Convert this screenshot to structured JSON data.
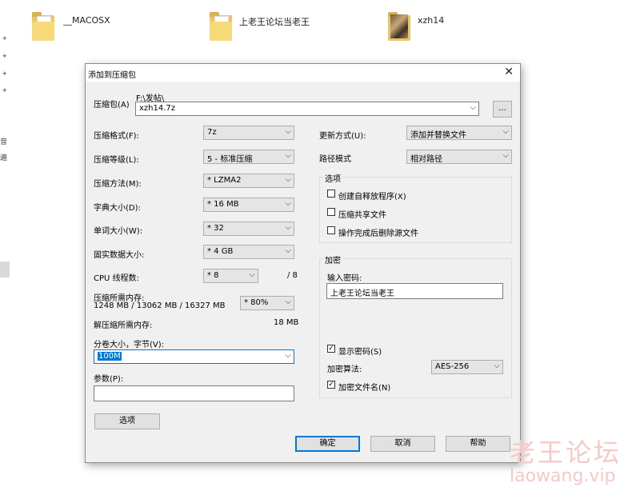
{
  "explorer": {
    "items": [
      {
        "label": "__MACOSX"
      },
      {
        "label": "上老王论坛当老王"
      },
      {
        "label": "xzh14"
      }
    ],
    "left_fragments": [
      "音",
      "遍"
    ]
  },
  "dialog": {
    "title": "添加到压缩包",
    "archive_label": "压缩包(A)",
    "archive_path": "F:\\发帖\\",
    "archive_name": "xzh14.7z",
    "browse_label": "...",
    "format": {
      "label": "压缩格式(F):",
      "value": "7z"
    },
    "level": {
      "label": "压缩等级(L):",
      "value": "5 - 标准压缩"
    },
    "method": {
      "label": "压缩方法(M):",
      "value": "* LZMA2"
    },
    "dict": {
      "label": "字典大小(D):",
      "value": "* 16 MB"
    },
    "word": {
      "label": "单词大小(W):",
      "value": "* 32"
    },
    "solid": {
      "label": "固实数据大小:",
      "value": "* 4 GB"
    },
    "cpu": {
      "label": "CPU 线程数:",
      "value": "* 8",
      "total": "/ 8"
    },
    "mem_comp": {
      "label": "压缩所需内存:",
      "detail": "1248 MB / 13062 MB / 16327 MB",
      "value": "* 80%"
    },
    "mem_decomp": {
      "label": "解压缩所需内存:",
      "value": "18 MB"
    },
    "split": {
      "label": "分卷大小，字节(V):",
      "value": "100M"
    },
    "params": {
      "label": "参数(P):",
      "value": ""
    },
    "options_button": "选项",
    "update_mode": {
      "label": "更新方式(U):",
      "value": "添加并替换文件"
    },
    "path_mode": {
      "label": "路径模式",
      "value": "相对路径"
    },
    "options_group": {
      "title": "选项",
      "items": [
        {
          "label": "创建自释放程序(X)",
          "checked": false
        },
        {
          "label": "压缩共享文件",
          "checked": false
        },
        {
          "label": "操作完成后删除源文件",
          "checked": false
        }
      ]
    },
    "encryption": {
      "title": "加密",
      "password_label": "输入密码:",
      "password_value": "上老王论坛当老王",
      "show_password": {
        "label": "显示密码(S)",
        "checked": true
      },
      "method_label": "加密算法:",
      "method_value": "AES-256",
      "encrypt_names": {
        "label": "加密文件名(N)",
        "checked": true
      }
    },
    "ok": "确定",
    "cancel": "取消",
    "help": "帮助"
  },
  "watermark": {
    "cn": "老王论坛",
    "url": "laowang.vip"
  }
}
